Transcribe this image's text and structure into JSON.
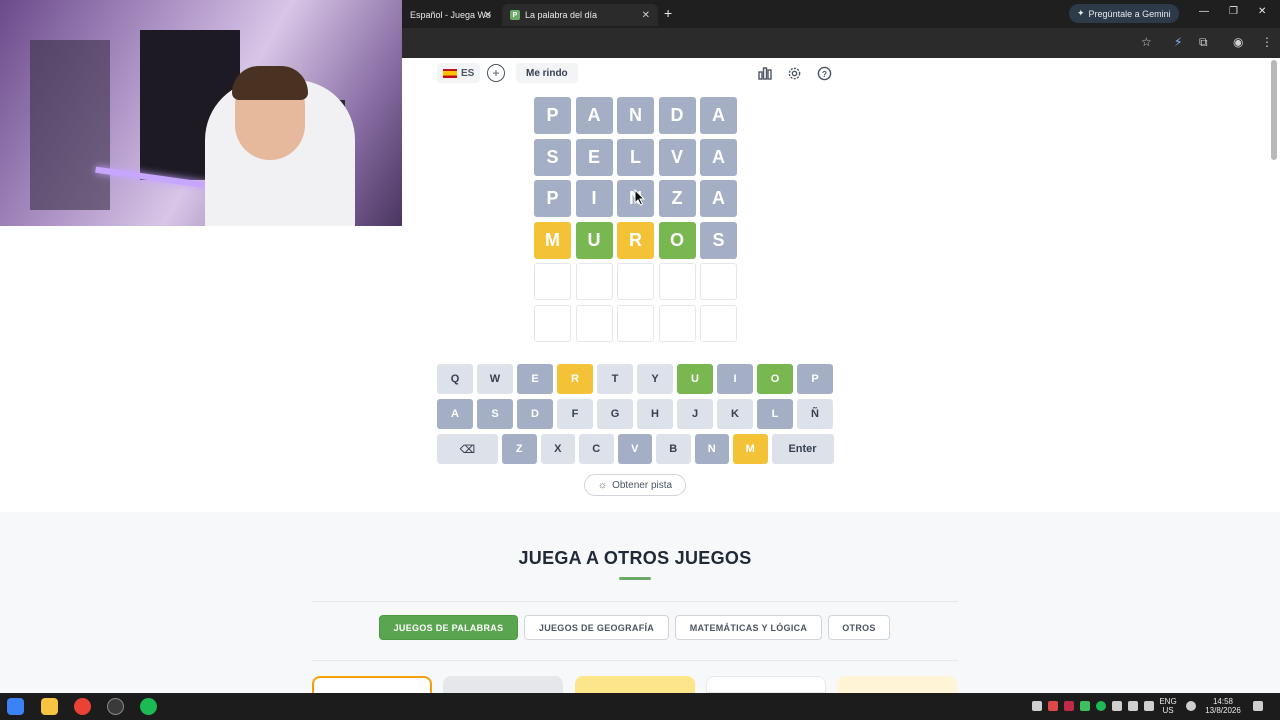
{
  "browser": {
    "tabs": [
      {
        "label": "Español - Juega Wo"
      },
      {
        "label": "La palabra del día"
      }
    ],
    "gemini_label": "Pregúntale a Gemini"
  },
  "header": {
    "language": "ES",
    "give_up": "Me rindo"
  },
  "board": {
    "rows": [
      [
        {
          "letter": "P",
          "state": "absent"
        },
        {
          "letter": "A",
          "state": "absent"
        },
        {
          "letter": "N",
          "state": "absent"
        },
        {
          "letter": "D",
          "state": "absent"
        },
        {
          "letter": "A",
          "state": "absent"
        }
      ],
      [
        {
          "letter": "S",
          "state": "absent"
        },
        {
          "letter": "E",
          "state": "absent"
        },
        {
          "letter": "L",
          "state": "absent"
        },
        {
          "letter": "V",
          "state": "absent"
        },
        {
          "letter": "A",
          "state": "absent"
        }
      ],
      [
        {
          "letter": "P",
          "state": "absent"
        },
        {
          "letter": "I",
          "state": "absent"
        },
        {
          "letter": "N",
          "state": "absent"
        },
        {
          "letter": "Z",
          "state": "absent"
        },
        {
          "letter": "A",
          "state": "absent"
        }
      ],
      [
        {
          "letter": "M",
          "state": "present"
        },
        {
          "letter": "U",
          "state": "correct"
        },
        {
          "letter": "R",
          "state": "present"
        },
        {
          "letter": "O",
          "state": "correct"
        },
        {
          "letter": "S",
          "state": "absent"
        }
      ],
      [
        {
          "letter": "",
          "state": "empty"
        },
        {
          "letter": "",
          "state": "empty"
        },
        {
          "letter": "",
          "state": "empty"
        },
        {
          "letter": "",
          "state": "empty"
        },
        {
          "letter": "",
          "state": "empty"
        }
      ],
      [
        {
          "letter": "",
          "state": "empty"
        },
        {
          "letter": "",
          "state": "empty"
        },
        {
          "letter": "",
          "state": "empty"
        },
        {
          "letter": "",
          "state": "empty"
        },
        {
          "letter": "",
          "state": "empty"
        }
      ]
    ]
  },
  "keyboard": {
    "row1": [
      {
        "label": "Q",
        "state": "unused"
      },
      {
        "label": "W",
        "state": "unused"
      },
      {
        "label": "E",
        "state": "absent"
      },
      {
        "label": "R",
        "state": "present"
      },
      {
        "label": "T",
        "state": "unused"
      },
      {
        "label": "Y",
        "state": "unused"
      },
      {
        "label": "U",
        "state": "correct"
      },
      {
        "label": "I",
        "state": "absent"
      },
      {
        "label": "O",
        "state": "correct"
      },
      {
        "label": "P",
        "state": "absent"
      }
    ],
    "row2": [
      {
        "label": "A",
        "state": "absent"
      },
      {
        "label": "S",
        "state": "absent"
      },
      {
        "label": "D",
        "state": "absent"
      },
      {
        "label": "F",
        "state": "unused"
      },
      {
        "label": "G",
        "state": "unused"
      },
      {
        "label": "H",
        "state": "unused"
      },
      {
        "label": "J",
        "state": "unused"
      },
      {
        "label": "K",
        "state": "unused"
      },
      {
        "label": "L",
        "state": "absent"
      },
      {
        "label": "Ñ",
        "state": "unused"
      }
    ],
    "row3": [
      {
        "label": "⌫",
        "state": "unused",
        "name": "backspace-key"
      },
      {
        "label": "Z",
        "state": "absent"
      },
      {
        "label": "X",
        "state": "unused"
      },
      {
        "label": "C",
        "state": "unused"
      },
      {
        "label": "V",
        "state": "absent"
      },
      {
        "label": "B",
        "state": "unused"
      },
      {
        "label": "N",
        "state": "absent"
      },
      {
        "label": "M",
        "state": "present"
      },
      {
        "label": "Enter",
        "state": "unused",
        "name": "enter-key"
      }
    ]
  },
  "hint_label": "Obtener pista",
  "other_games": {
    "title": "JUEGA A OTROS JUEGOS",
    "filters": [
      "JUEGOS DE PALABRAS",
      "JUEGOS DE GEOGRAFÍA",
      "MATEMÁTICAS Y LÓGICA",
      "OTROS"
    ]
  },
  "taskbar": {
    "lang_top": "ENG",
    "lang_bottom": "US",
    "time": "14:58",
    "date": "13/8/2026"
  },
  "colors": {
    "absent": "#a4aec4",
    "present": "#f3c237",
    "correct": "#79b851",
    "filter_active": "#5aa550"
  }
}
